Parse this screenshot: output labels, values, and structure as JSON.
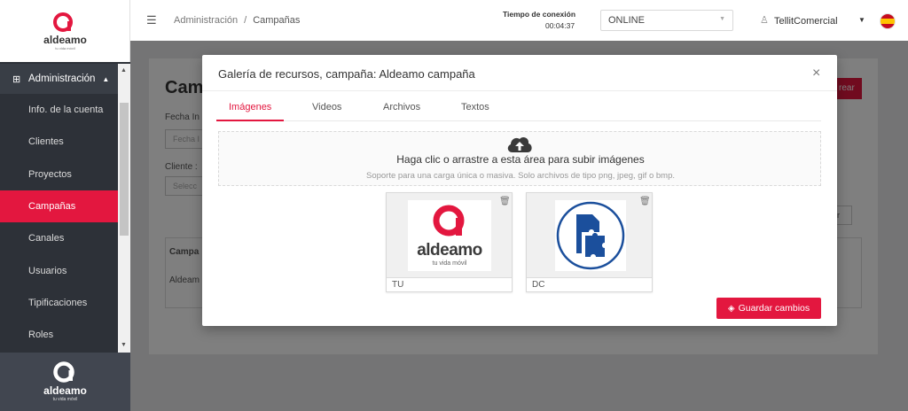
{
  "brand": {
    "name": "aldeamo",
    "tagline": "tu vida móvil",
    "color": "#e3173f"
  },
  "sidebar": {
    "section": "Administración",
    "items": [
      {
        "label": "Info. de la cuenta"
      },
      {
        "label": "Clientes"
      },
      {
        "label": "Proyectos"
      },
      {
        "label": "Campañas",
        "active": true
      },
      {
        "label": "Canales"
      },
      {
        "label": "Usuarios"
      },
      {
        "label": "Tipificaciones"
      },
      {
        "label": "Roles"
      }
    ]
  },
  "header": {
    "breadcrumb": [
      "Administración",
      "Campañas"
    ],
    "connection_label": "Tiempo de conexión",
    "connection_time": "00:04:37",
    "status": "ONLINE",
    "user": "TellitComercial"
  },
  "background_page": {
    "title": "Cam",
    "create_btn": "rear",
    "fecha_label": "Fecha In",
    "fecha_placeholder": "Fecha I",
    "cliente_label": "Cliente :",
    "cliente_placeholder": "Selecc",
    "table_header": "Campa",
    "table_row": "Aldeam",
    "filter_btn": "r"
  },
  "modal": {
    "title": "Galería de recursos, campaña: Aldeamo campaña",
    "tabs": [
      {
        "label": "Imágenes",
        "active": true
      },
      {
        "label": "Videos"
      },
      {
        "label": "Archivos"
      },
      {
        "label": "Textos"
      }
    ],
    "upload_title": "Haga clic o arrastre a esta área para subir imágenes",
    "upload_hint": "Soporte para una carga única o masiva. Solo archivos de tipo png, jpeg, gif o bmp.",
    "images": [
      {
        "caption": "TU",
        "logo_text": "aldeamo",
        "logo_tagline": "tu vida móvil"
      },
      {
        "caption": "DC"
      }
    ],
    "save_label": "Guardar cambios"
  }
}
